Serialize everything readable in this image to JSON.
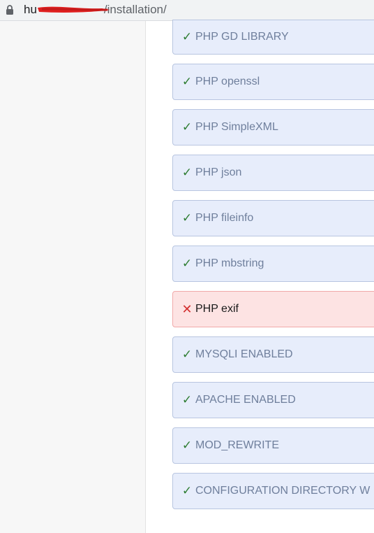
{
  "browser": {
    "url_host_visible": "hu",
    "url_path": "/installation/",
    "lock_icon": "lock-icon"
  },
  "colors": {
    "ok_mark": "#2e7d32",
    "fail_mark": "#d32f2f",
    "ok_bg": "#e7edfb",
    "fail_bg": "#fde3e3"
  },
  "checks": [
    {
      "label": "PHP GD LIBRARY",
      "status": "ok",
      "mark": "✓"
    },
    {
      "label": "PHP openssl",
      "status": "ok",
      "mark": "✓"
    },
    {
      "label": "PHP SimpleXML",
      "status": "ok",
      "mark": "✓"
    },
    {
      "label": "PHP json",
      "status": "ok",
      "mark": "✓"
    },
    {
      "label": "PHP fileinfo",
      "status": "ok",
      "mark": "✓"
    },
    {
      "label": "PHP mbstring",
      "status": "ok",
      "mark": "✓"
    },
    {
      "label": "PHP exif",
      "status": "fail",
      "mark": "✕"
    },
    {
      "label": "MYSQLI ENABLED",
      "status": "ok",
      "mark": "✓"
    },
    {
      "label": "APACHE ENABLED",
      "status": "ok",
      "mark": "✓"
    },
    {
      "label": "MOD_REWRITE",
      "status": "ok",
      "mark": "✓"
    },
    {
      "label": "CONFIGURATION DIRECTORY W",
      "status": "ok",
      "mark": "✓"
    }
  ]
}
